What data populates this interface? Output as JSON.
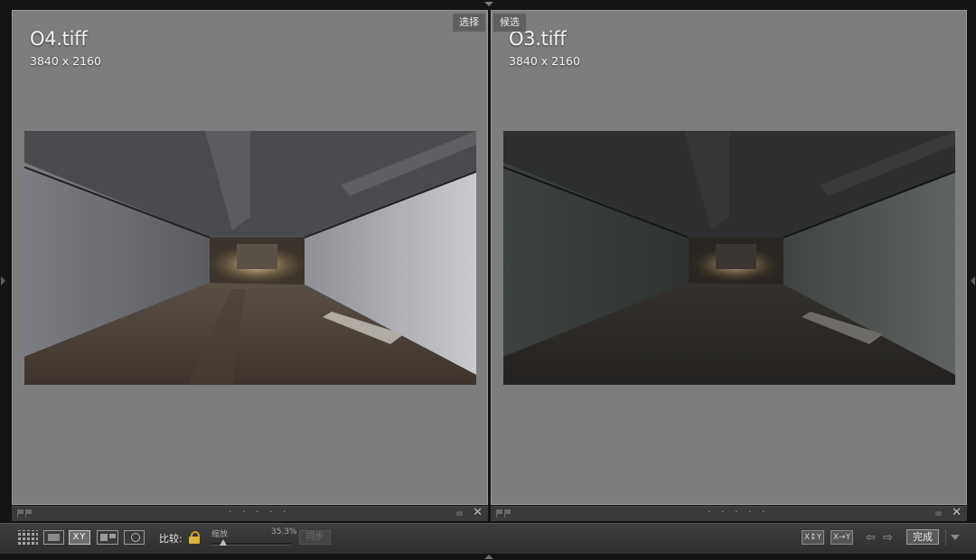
{
  "left_pane": {
    "filename": "O4.tiff",
    "dimensions": "3840 x 2160",
    "tag": "选择",
    "strip_dots": "· · · · ·"
  },
  "right_pane": {
    "filename": "O3.tiff",
    "dimensions": "3840 x 2160",
    "tag": "候选",
    "strip_dots": "· · · · ·"
  },
  "toolbar": {
    "view_xy_label": "XY",
    "compare_label": "比较:",
    "zoom_label": "缩放",
    "zoom_value": "35.3%",
    "zoom_fraction": 0.15,
    "sync_label": "同步",
    "swap_label": "X↕Y",
    "promote_label": "X→Y",
    "prev_arrow": "⇦",
    "next_arrow": "⇨",
    "done_label": "完成",
    "close_glyph": "✕"
  },
  "colors": {
    "pane_bg": "#7d7d7d",
    "toolbar_bg": "#353535",
    "lock_gold": "#d7b43a"
  },
  "icons": [
    "grid-view-icon",
    "loupe-view-icon",
    "compare-view-icon",
    "survey-view-icon",
    "people-view-icon",
    "lock-icon",
    "flag-icon",
    "close-icon",
    "chevron-down-icon"
  ]
}
